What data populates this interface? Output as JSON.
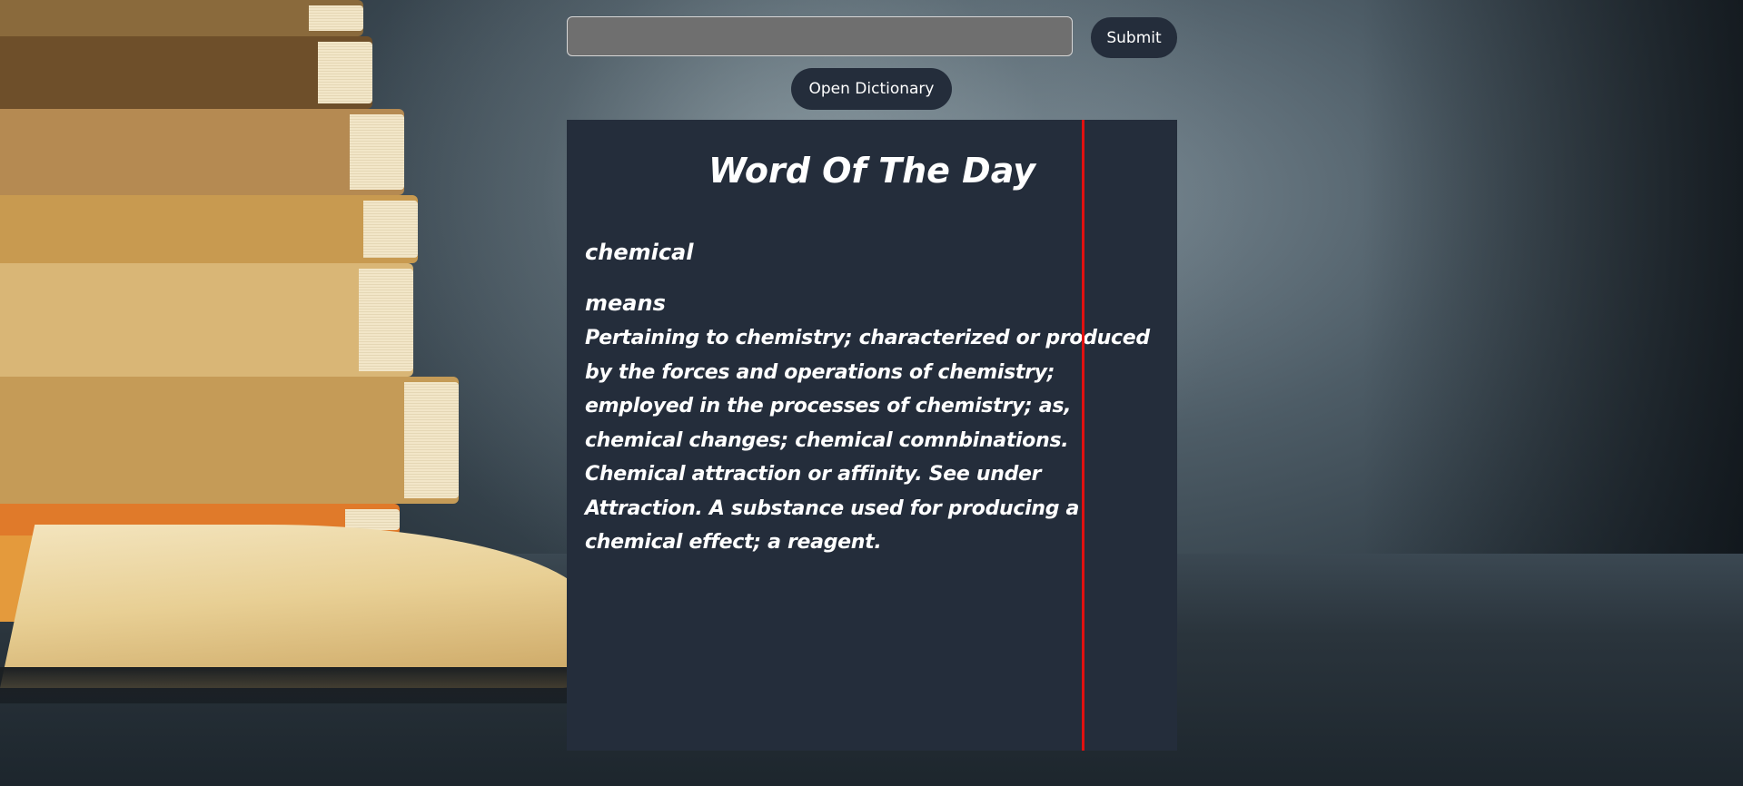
{
  "search": {
    "value": "",
    "placeholder": ""
  },
  "buttons": {
    "submit_label": "Submit",
    "open_dictionary_label": "Open Dictionary"
  },
  "word_of_the_day": {
    "title": "Word Of The Day",
    "word": "chemical",
    "means_label": "means",
    "definition": "Pertaining to chemistry; characterized or produced by the forces and operations of chemistry; employed in the processes of chemistry; as, chemical changes; chemical comnbinations. Chemical attraction or affinity. See under Attraction. A substance used for producing a chemical effect; a reagent."
  },
  "colors": {
    "panel_background": "#242d3b",
    "button_background": "#242d3b",
    "input_background": "#6f6f6f",
    "divider": "#e01010",
    "text": "#ffffff"
  }
}
